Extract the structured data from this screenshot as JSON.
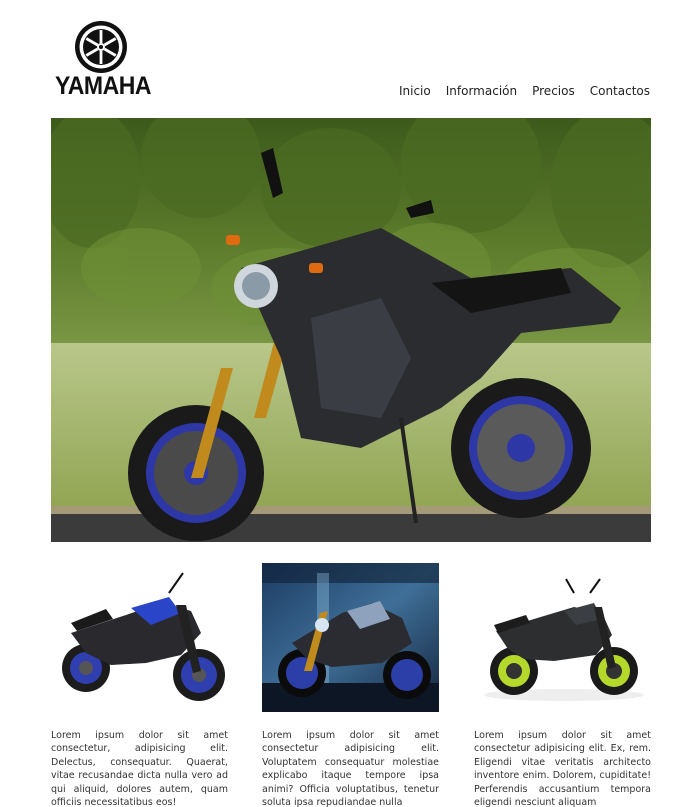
{
  "brand": {
    "name": "YAMAHA"
  },
  "nav": {
    "items": [
      "Inicio",
      "Información",
      "Precios",
      "Contactos"
    ]
  },
  "hero": {
    "image": "motorcycle-hero-image"
  },
  "gallery": [
    {
      "image": "blue-motorcycle-image",
      "text": "Lorem ipsum dolor sit amet consectetur, adipisicing elit. Delectus, consequatur. Quaerat, vitae recusandae dicta nulla vero ad qui aliquid, dolores autem, quam officiis necessitatibus eos!"
    },
    {
      "image": "night-motorcycle-image",
      "text": "Lorem ipsum dolor sit amet consectetur adipisicing elit. Voluptatem consequatur molestiae explicabo itaque tempore ipsa animi? Officia voluptatibus, tenetur soluta ipsa repudiandae nulla"
    },
    {
      "image": "green-motorcycle-image",
      "text": "Lorem ipsum dolor sit amet consectetur adipisicing elit. Ex, rem. Eligendi vitae veritatis architecto inventore enim. Dolorem, cupiditate! Perferendis accusantium tempora eligendi nesciunt aliquam"
    }
  ],
  "colors": {
    "accent_blue": "#2f3fb0",
    "lime": "#b4d92a",
    "gold": "#c08a1c"
  }
}
